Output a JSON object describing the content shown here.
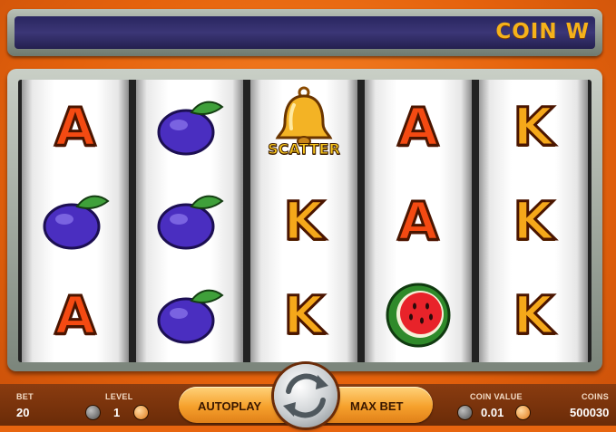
{
  "ticker": {
    "text": "COIN W"
  },
  "reels": [
    {
      "symbols": [
        "A",
        "plum",
        "A"
      ]
    },
    {
      "symbols": [
        "plum",
        "plum",
        "plum"
      ]
    },
    {
      "symbols": [
        "scatter-bell",
        "K",
        "K"
      ]
    },
    {
      "symbols": [
        "A",
        "A",
        "watermelon"
      ]
    },
    {
      "symbols": [
        "K",
        "K",
        "K"
      ]
    }
  ],
  "scatter_label": "SCATTER",
  "bet": {
    "label": "BET",
    "value": "20"
  },
  "level": {
    "label": "LEVEL",
    "value": "1"
  },
  "autoplay_label": "AUTOPLAY",
  "max_bet_label": "MAX BET",
  "coin_value": {
    "label": "COIN VALUE",
    "value": "0.01"
  },
  "coins": {
    "label": "COINS",
    "value": "500030"
  },
  "colors": {
    "accent": "#f5a81a",
    "frame": "#e8650f",
    "ticker_bg": "#2f2b6a"
  }
}
